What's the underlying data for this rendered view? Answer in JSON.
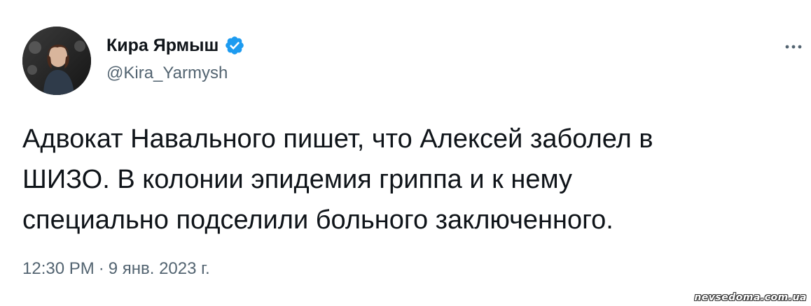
{
  "author": {
    "name": "Кира Ярмыш",
    "handle": "@Kira_Yarmysh",
    "verified": true,
    "verified_color": "#1d9bf0"
  },
  "more_icon": "more-horizontal-icon",
  "tweet": {
    "lines": [
      "Адвокат Навального пишет, что Алексей заболел в",
      "ШИЗО. В колонии эпидемия гриппа и к нему",
      "специально подселили больного заключенного."
    ]
  },
  "meta": {
    "time": "12:30 PM",
    "separator": "·",
    "date": "9 янв. 2023 г."
  },
  "watermark": "nevsedoma.com.ua",
  "colors": {
    "text_primary": "#0f1419",
    "text_secondary": "#536471",
    "background": "#ffffff"
  }
}
